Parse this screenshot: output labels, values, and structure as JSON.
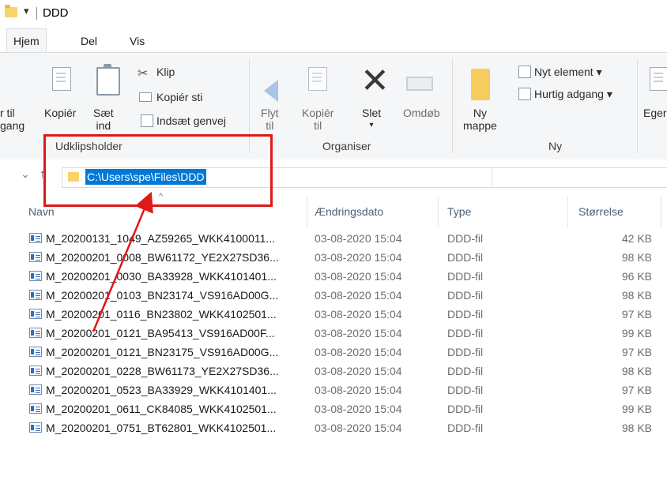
{
  "window": {
    "title": "DDD",
    "qat_glyph": "▾"
  },
  "tabs": [
    {
      "label": "Hjem",
      "active": true
    },
    {
      "label": "Del",
      "active": false
    },
    {
      "label": "Vis",
      "active": false
    }
  ],
  "ribbon": {
    "pin_label_1": "r til",
    "pin_label_2": "gang",
    "copy": "Kopiér",
    "paste_1": "Sæt",
    "paste_2": "ind",
    "cut": "Klip",
    "copy_path": "Kopiér sti",
    "paste_shortcut": "Indsæt genvej",
    "clipboard_group": "Udklipsholder",
    "move_1": "Flyt",
    "move_2": "til",
    "copyto_1": "Kopiér",
    "copyto_2": "til",
    "delete": "Slet",
    "delete_caret": "▾",
    "rename": "Omdøb",
    "organise_group": "Organiser",
    "newfolder_1": "Ny",
    "newfolder_2": "mappe",
    "new_item": "Nyt element ▾",
    "easy_access": "Hurtig adgang ▾",
    "new_group": "Ny",
    "properties_partial": "Eger"
  },
  "nav": {
    "recent_glyph": "⌄",
    "up_glyph": "↑",
    "path": "C:\\Users\\spe\\Files\\DDD"
  },
  "columns": {
    "name": "Navn",
    "date": "Ændringsdato",
    "type": "Type",
    "size": "Størrelse",
    "sort_glyph": "^"
  },
  "files": [
    {
      "name": "M_20200131_1049_AZ59265_WKK4100011...",
      "date": "03-08-2020 15:04",
      "type": "DDD-fil",
      "size": "42 KB"
    },
    {
      "name": "M_20200201_0008_BW61172_YE2X27SD36...",
      "date": "03-08-2020 15:04",
      "type": "DDD-fil",
      "size": "98 KB"
    },
    {
      "name": "M_20200201_0030_BA33928_WKK4101401...",
      "date": "03-08-2020 15:04",
      "type": "DDD-fil",
      "size": "96 KB"
    },
    {
      "name": "M_20200201_0103_BN23174_VS916AD00G...",
      "date": "03-08-2020 15:04",
      "type": "DDD-fil",
      "size": "98 KB"
    },
    {
      "name": "M_20200201_0116_BN23802_WKK4102501...",
      "date": "03-08-2020 15:04",
      "type": "DDD-fil",
      "size": "97 KB"
    },
    {
      "name": "M_20200201_0121_BA95413_VS916AD00F...",
      "date": "03-08-2020 15:04",
      "type": "DDD-fil",
      "size": "99 KB"
    },
    {
      "name": "M_20200201_0121_BN23175_VS916AD00G...",
      "date": "03-08-2020 15:04",
      "type": "DDD-fil",
      "size": "97 KB"
    },
    {
      "name": "M_20200201_0228_BW61173_YE2X27SD36...",
      "date": "03-08-2020 15:04",
      "type": "DDD-fil",
      "size": "98 KB"
    },
    {
      "name": "M_20200201_0523_BA33929_WKK4101401...",
      "date": "03-08-2020 15:04",
      "type": "DDD-fil",
      "size": "97 KB"
    },
    {
      "name": "M_20200201_0611_CK84085_WKK4102501...",
      "date": "03-08-2020 15:04",
      "type": "DDD-fil",
      "size": "99 KB"
    },
    {
      "name": "M_20200201_0751_BT62801_WKK4102501...",
      "date": "03-08-2020 15:04",
      "type": "DDD-fil",
      "size": "98 KB"
    }
  ],
  "annotation": {
    "color": "#e01818"
  }
}
